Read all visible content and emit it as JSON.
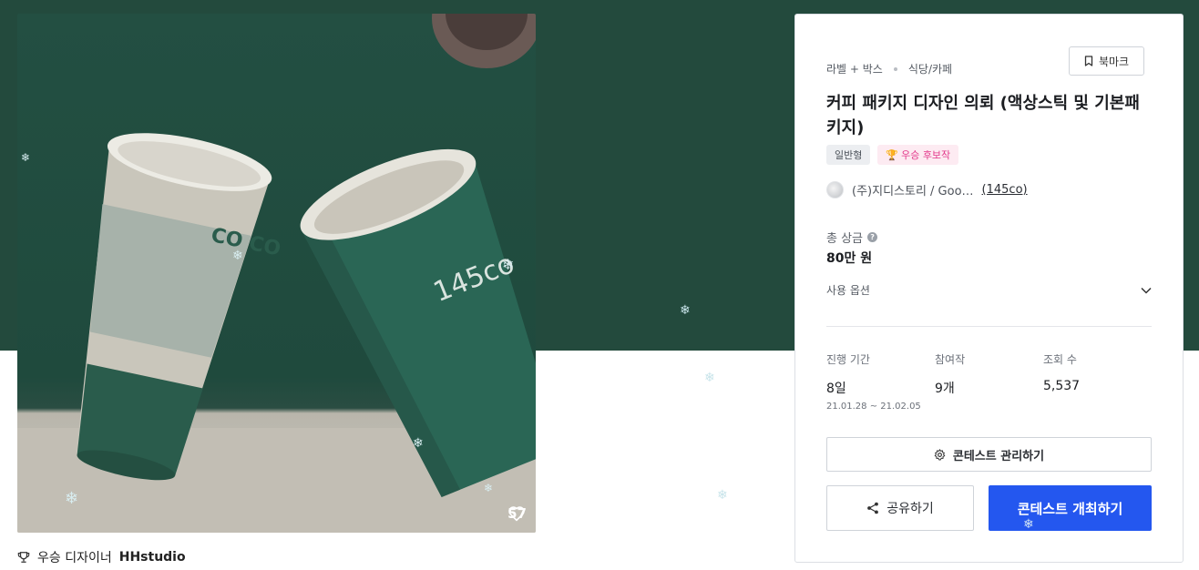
{
  "hero": {
    "cup_left_logo": "CO CO",
    "cup_right_logo": "145co",
    "likes": "57"
  },
  "winner": {
    "prefix": "우승 디자이너",
    "name": "HHstudio"
  },
  "panel": {
    "breadcrumb": [
      "라벨 + 박스",
      "식당/카페"
    ],
    "bookmark_label": "북마크",
    "title": "커피 패키지 디자인 의뢰 (액상스틱 및 기본패키지)",
    "tags": {
      "type": "일반형",
      "award": "우승 후보작"
    },
    "host": {
      "name": "(주)지디스토리 / Goo…",
      "brand_link": "(145co)"
    },
    "prize": {
      "label": "총 상금",
      "help_icon": "?",
      "value": "80만 원"
    },
    "usage_label": "사용 옵션",
    "stats": [
      {
        "label": "진행 기간",
        "value": "8일",
        "sub": "21.01.28 ~ 21.02.05"
      },
      {
        "label": "참여작",
        "value": "9개",
        "sub": ""
      },
      {
        "label": "조회 수",
        "value": "5,537",
        "sub": ""
      }
    ],
    "buttons": {
      "manage": "콘테스트 관리하기",
      "share": "공유하기",
      "host": "콘테스트 개최하기"
    }
  },
  "colors": {
    "hero_bg": "#234a3d",
    "primary_button": "#2457ef",
    "award_tag_text": "#e3388b",
    "award_tag_bg": "#fdebf2"
  },
  "icons": [
    "heart-icon",
    "trophy-icon",
    "bookmark-icon",
    "question-icon",
    "chevron-down-icon",
    "gear-icon",
    "share-icon",
    "snowflake-icon"
  ]
}
